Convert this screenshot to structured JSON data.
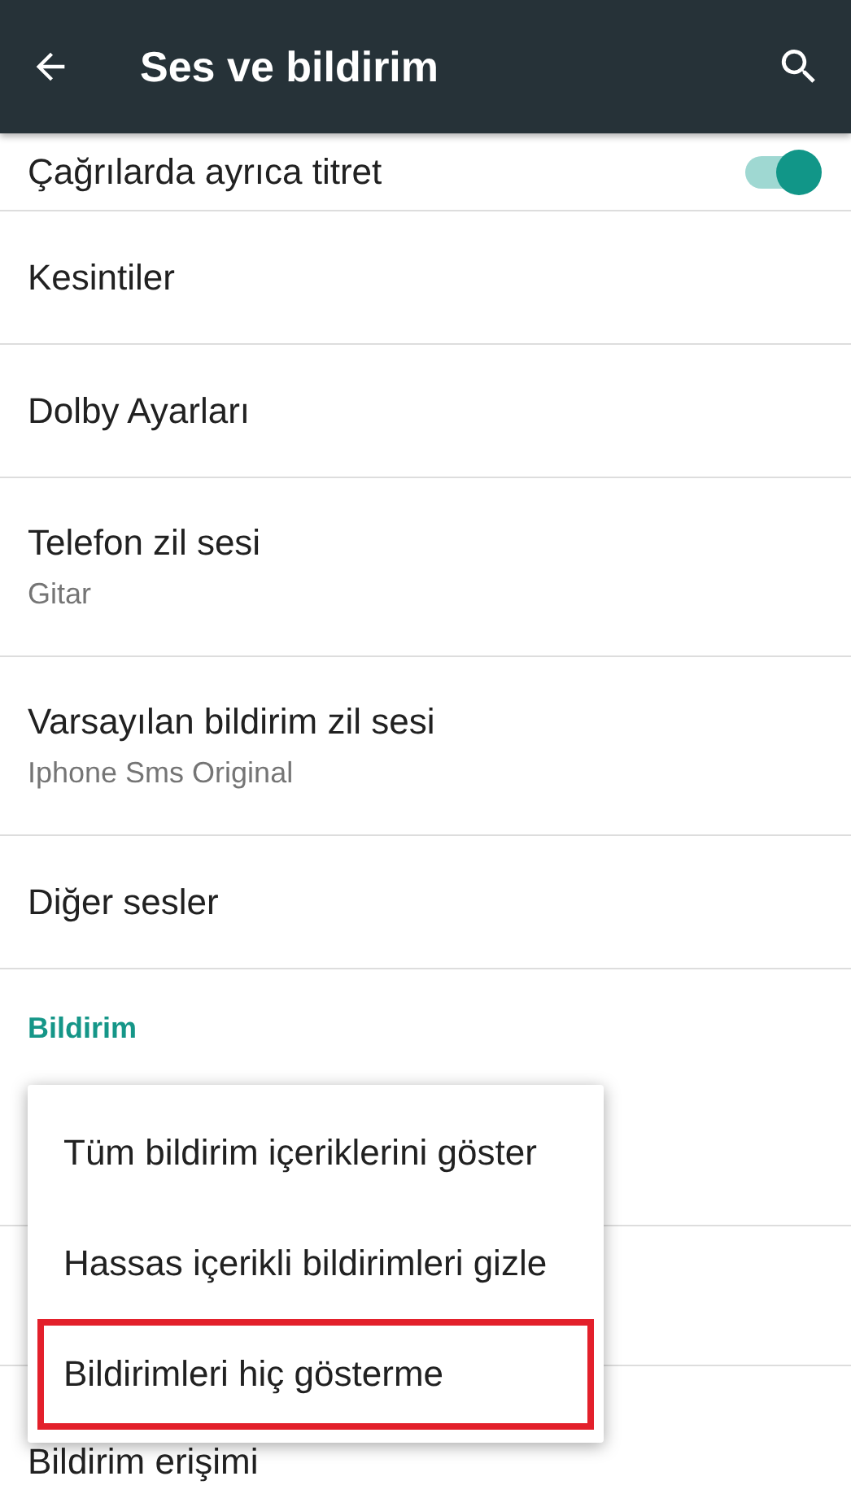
{
  "app_bar": {
    "title": "Ses ve bildirim"
  },
  "settings": [
    {
      "kind": "switch",
      "title": "Çağrılarda ayrıca titret",
      "on": true
    },
    {
      "kind": "plain",
      "title": "Kesintiler"
    },
    {
      "kind": "plain",
      "title": "Dolby Ayarları"
    },
    {
      "kind": "plain",
      "title": "Telefon zil sesi",
      "summary": "Gitar"
    },
    {
      "kind": "plain",
      "title": "Varsayılan bildirim zil sesi",
      "summary": "Iphone Sms Original"
    },
    {
      "kind": "plain",
      "title": "Diğer sesler"
    },
    {
      "kind": "header",
      "title": "Bildirim"
    },
    {
      "kind": "hidden"
    },
    {
      "kind": "hidden"
    },
    {
      "kind": "plain",
      "title": "Bildirim erişimi"
    }
  ],
  "popup_menu": {
    "options": [
      {
        "label": "Tüm bildirim içeriklerini göster",
        "highlighted": false
      },
      {
        "label": "Hassas içerikli bildirimleri gizle",
        "highlighted": false
      },
      {
        "label": "Bildirimleri hiç gösterme",
        "highlighted": true
      }
    ]
  }
}
